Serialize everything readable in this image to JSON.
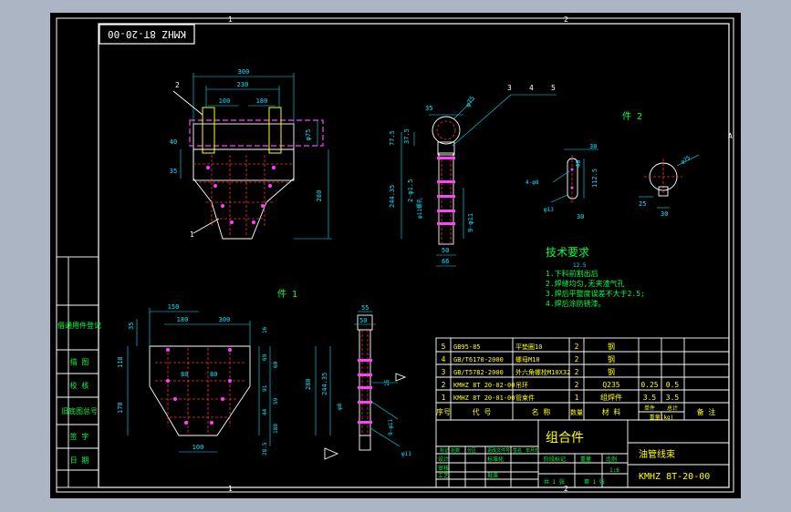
{
  "colors": {
    "background": "#acb5c4",
    "paper": "#000000",
    "border": "#ffffff",
    "outline": "#ffffff",
    "dims": "#00e5ff",
    "green": "#00ff3c",
    "yellow": "#ffff00",
    "red": "#ff2a2a",
    "magenta": "#ff40ff"
  },
  "drawing": {
    "drawing_number_box": "KMHZ 8T-20-00",
    "zone_top": [
      "1",
      "2"
    ],
    "zone_bottom": [
      "1",
      "2"
    ],
    "zone_right": "A",
    "part_labels": [
      "件 1",
      "件 2"
    ],
    "left_column_labels": [
      "借通用件登记",
      "描 图",
      "校 核",
      "旧底图总号",
      "签 字",
      "日 期"
    ],
    "callouts_a": [
      "2",
      "1"
    ],
    "callouts_b": [
      "3",
      "4",
      "5"
    ],
    "view_a_dims": [
      "300",
      "230",
      "100",
      "180",
      "40",
      "35",
      "280",
      "φ75"
    ],
    "view_b_dims": [
      "35",
      "φ75",
      "77.5",
      "37.5",
      "244.35",
      "2-φ1.5",
      "50",
      "66",
      "9-φ11",
      "φ11螺孔"
    ],
    "view_c_dims": [
      "30",
      "4-φ8",
      "40",
      "112.5",
      "φ13",
      "30",
      "φ75",
      "25",
      "30"
    ],
    "view_d_dims": [
      "150",
      "180",
      "300",
      "35",
      "110",
      "170",
      "80",
      "80",
      "16",
      "69",
      "91",
      "44",
      "60",
      "59",
      "180",
      "100",
      "28.5"
    ],
    "view_e_dims": [
      "55",
      "50",
      "280",
      "244.35",
      "15",
      "φ8",
      "9-φ11",
      "φ11"
    ]
  },
  "tech_req": {
    "title": "技术要求",
    "items": [
      "1.下料前割出后",
      "2.焊缝均匀,无夹渣气孔",
      "3.焊后平整度误差不大于2.5;",
      "4.焊后涂防锈漆。"
    ],
    "roughness": "12.5"
  },
  "bom": {
    "rows": [
      {
        "seq": "5",
        "code": "GB95-85",
        "name": "平垫圈10",
        "qty": "2",
        "material": "钢",
        "unit": "",
        "total": "",
        "note": ""
      },
      {
        "seq": "4",
        "code": "GB/T6170-2000",
        "name": "螺母M10",
        "qty": "2",
        "material": "钢",
        "unit": "",
        "total": "",
        "note": ""
      },
      {
        "seq": "3",
        "code": "GB/T5782-2000",
        "name": "外六角螺栓M10X32",
        "qty": "2",
        "material": "钢",
        "unit": "",
        "total": "",
        "note": ""
      },
      {
        "seq": "2",
        "code": "KMHZ 8T 20-02-00",
        "name": "吊环",
        "qty": "2",
        "material": "Q235",
        "unit": "0.25",
        "total": "0.5",
        "note": ""
      },
      {
        "seq": "1",
        "code": "KMHZ 8T 20-01-00",
        "name": "管束件",
        "qty": "1",
        "material": "组焊件",
        "unit": "3.5",
        "total": "3.5",
        "note": ""
      }
    ],
    "headers": [
      "序号",
      "代 号",
      "名 称",
      "数量",
      "材 料",
      "单件",
      "总计",
      "备 注"
    ],
    "weight_header": "重量(kg)"
  },
  "title_block": {
    "assembly": "组合件",
    "name": "油管线束",
    "number": "KMHZ 8T-20-00",
    "sub_labels": [
      "标记",
      "处数",
      "分区",
      "更改文件号",
      "签名",
      "年月日"
    ],
    "role_labels": [
      "设计",
      "标准化",
      "审核",
      "工艺",
      "批准"
    ],
    "stage": "阶段标记",
    "weight": "重量",
    "scale": "比例",
    "scale_value": "1:6",
    "sheet": "共 1 张",
    "sheet_no": "第 1 张"
  }
}
